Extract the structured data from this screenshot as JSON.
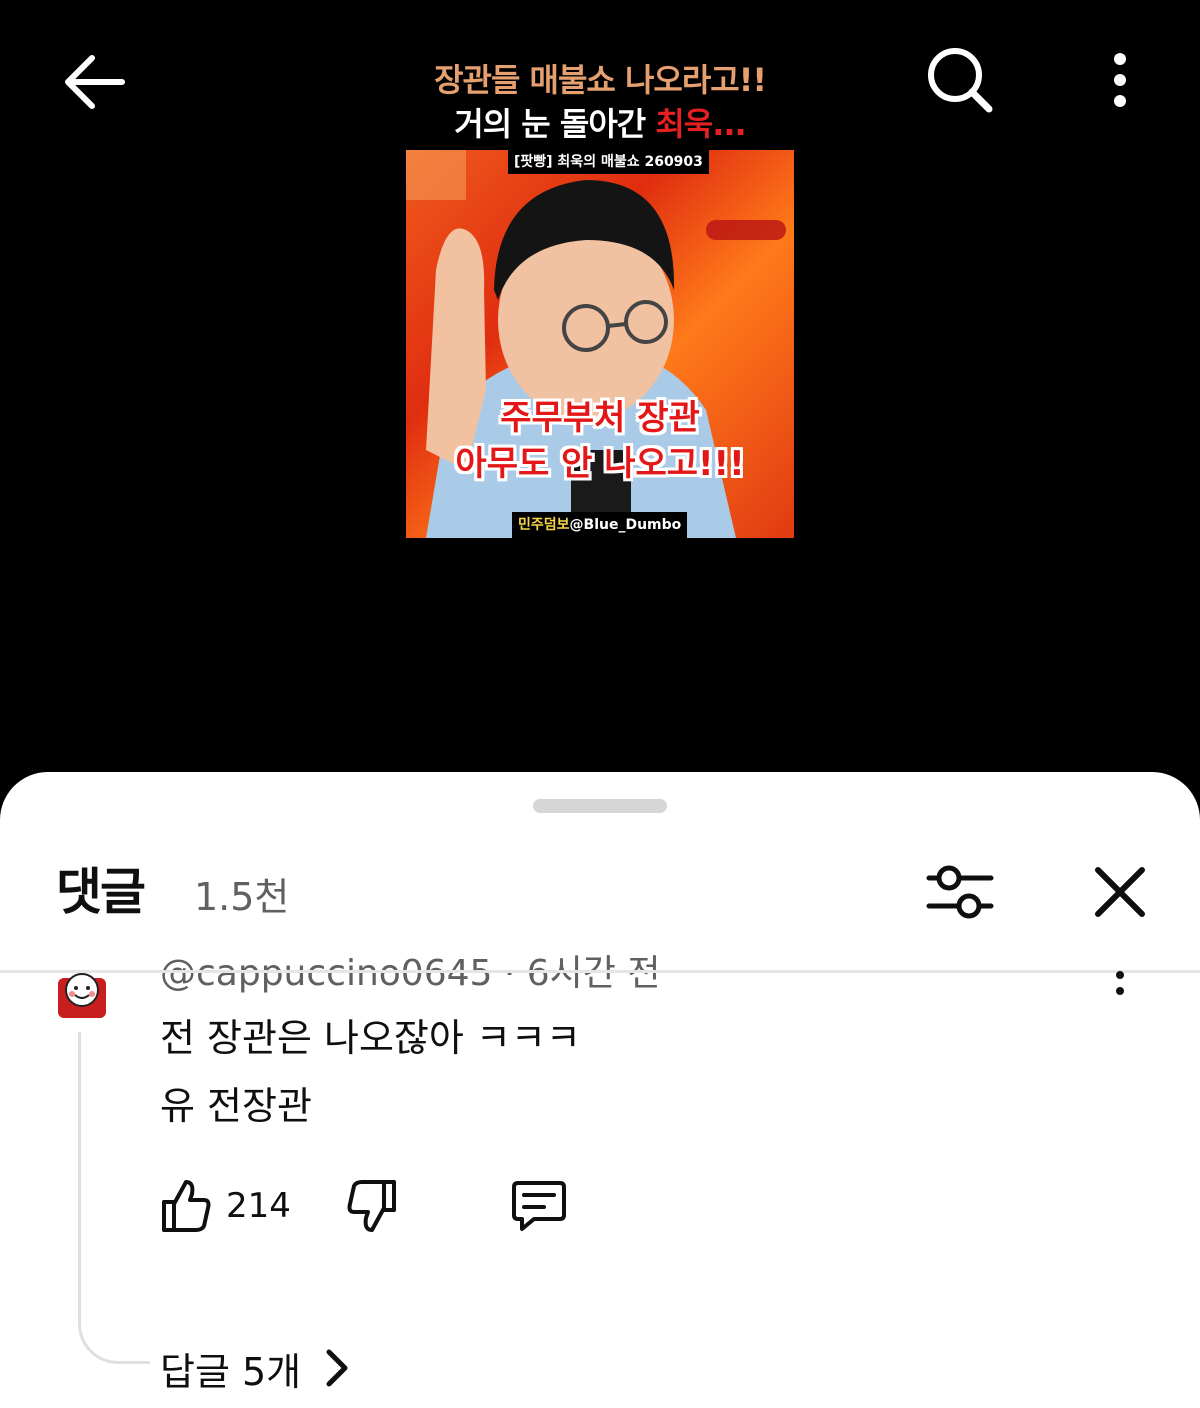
{
  "top_bar": {
    "back_icon": "arrow-left-icon",
    "search_icon": "search-icon",
    "more_icon": "more-vertical-icon"
  },
  "video": {
    "title_line1": "장관들 매불쇼 나오라고!!",
    "title_line2_a": "거의 눈 돌아간 ",
    "title_line2_b": "최욱...",
    "thumb_tag": "[팟빵] 최욱의 매불쇼 260903",
    "thumb_caption_1": "주무부처 장관",
    "thumb_caption_2": "아무도 안 나오고!!!",
    "thumb_credit_a": "민주덤보",
    "thumb_credit_b": "@Blue_Dumbo",
    "colors": {
      "title_orange": "#e6a070",
      "accent_red": "#e52020"
    }
  },
  "comments_sheet": {
    "title": "댓글",
    "count": "1.5천",
    "filter_icon": "sliders-icon",
    "close_icon": "close-icon",
    "comment": {
      "meta": "@cappuccino0645 · 6시간 전",
      "line1": "전 장관은 나오잖아 ㅋㅋㅋ",
      "line2": "유 전장관",
      "likes": "214",
      "like_icon": "thumbs-up-icon",
      "dislike_icon": "thumbs-down-icon",
      "reply_icon": "comment-icon",
      "replies_label": "답글 5개",
      "replies_icon": "chevron-right-icon"
    }
  }
}
